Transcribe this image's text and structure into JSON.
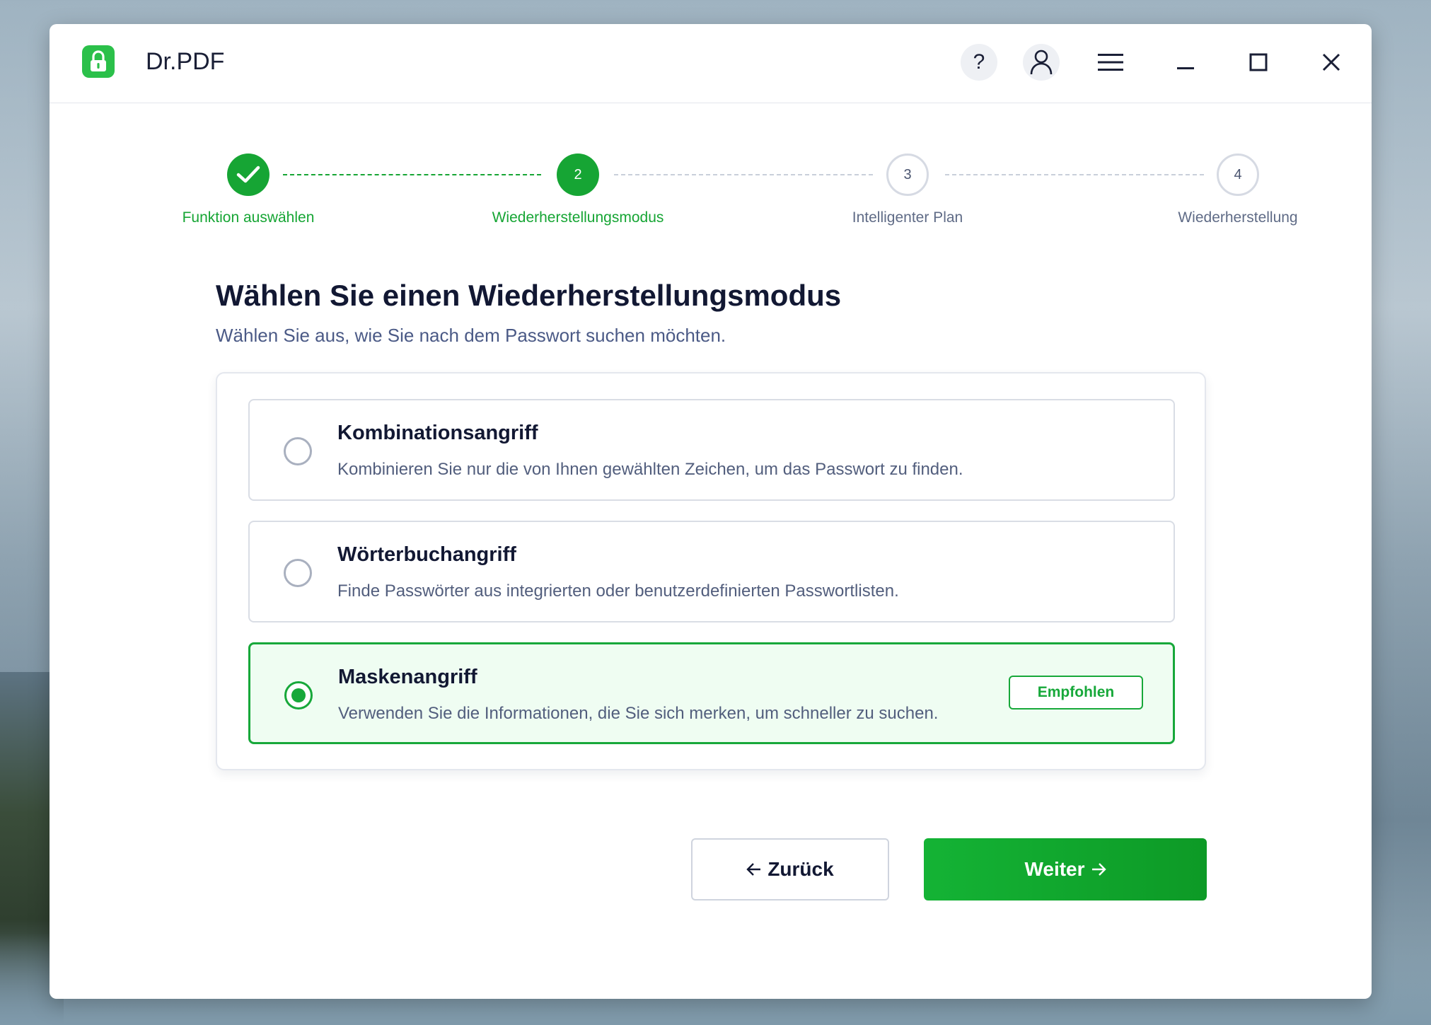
{
  "app": {
    "title": "Dr.PDF",
    "logo_icon": "lock-icon",
    "accent_color": "#16a534"
  },
  "titlebar": {
    "help_label": "?",
    "icons": [
      "help-icon",
      "account-icon",
      "menu-icon",
      "minimize-icon",
      "maximize-icon",
      "close-icon"
    ]
  },
  "stepper": {
    "steps": [
      {
        "number": "1",
        "label": "Funktion auswählen",
        "state": "done"
      },
      {
        "number": "2",
        "label": "Wiederherstellungsmodus",
        "state": "active"
      },
      {
        "number": "3",
        "label": "Intelligenter Plan",
        "state": "todo"
      },
      {
        "number": "4",
        "label": "Wiederherstellung",
        "state": "todo"
      }
    ]
  },
  "main": {
    "heading": "Wählen Sie einen Wiederherstellungsmodus",
    "subheading": "Wählen Sie aus, wie Sie nach dem Passwort suchen möchten.",
    "options": [
      {
        "title": "Kombinationsangriff",
        "description": "Kombinieren Sie nur die von Ihnen gewählten Zeichen, um das Passwort zu finden.",
        "selected": false
      },
      {
        "title": "Wörterbuchangriff",
        "description": "Finde Passwörter aus integrierten oder benutzerdefinierten Passwortlisten.",
        "selected": false
      },
      {
        "title": "Maskenangriff",
        "description": "Verwenden Sie die Informationen, die Sie sich merken, um schneller zu suchen.",
        "selected": true,
        "badge": "Empfohlen"
      }
    ]
  },
  "footer": {
    "back_label": "Zurück",
    "next_label": "Weiter"
  }
}
